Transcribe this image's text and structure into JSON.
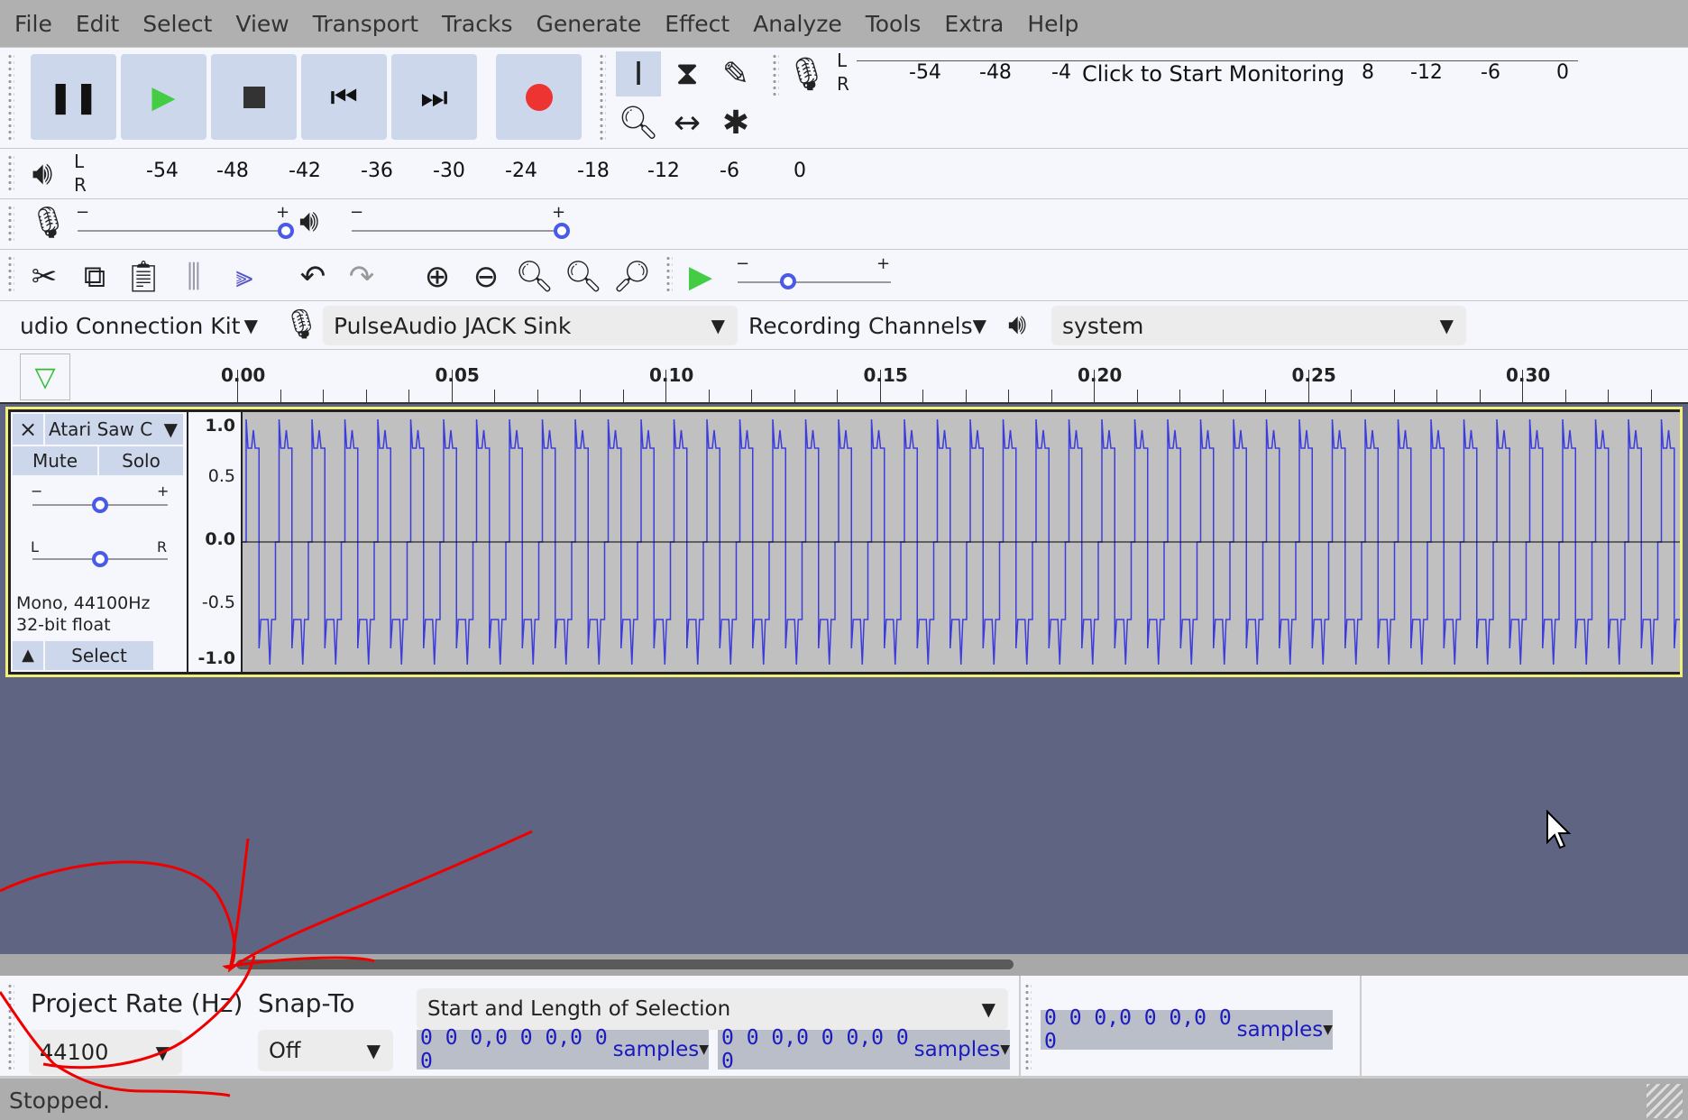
{
  "menu": [
    "File",
    "Edit",
    "Select",
    "View",
    "Transport",
    "Tracks",
    "Generate",
    "Effect",
    "Analyze",
    "Tools",
    "Extra",
    "Help"
  ],
  "transport": {
    "pause": "pause-icon",
    "play": "play-icon",
    "stop": "stop-icon",
    "skip_start": "skip-start-icon",
    "skip_end": "skip-end-icon",
    "record": "record-icon"
  },
  "record_meter": {
    "ticks": [
      "-54",
      "-48",
      "-4",
      "8",
      "-12",
      "-6",
      "0"
    ],
    "prompt": "Click to Start Monitoring",
    "l": "L",
    "r": "R"
  },
  "play_meter": {
    "ticks": [
      "-54",
      "-48",
      "-42",
      "-36",
      "-30",
      "-24",
      "-18",
      "-12",
      "-6",
      "0"
    ],
    "l": "L",
    "r": "R"
  },
  "mixer": {
    "minus": "−",
    "plus": "+",
    "rec_volume": 1.0,
    "play_volume": 1.0
  },
  "play_speed": {
    "minus": "−",
    "plus": "+",
    "value": 0.35
  },
  "devices": {
    "host": "udio Connection Kit",
    "playback": "PulseAudio JACK Sink",
    "channels": "Recording Channels",
    "output": "system"
  },
  "ruler": {
    "ticks": [
      "0.00",
      "0.05",
      "0.10",
      "0.15",
      "0.20",
      "0.25",
      "0.30"
    ]
  },
  "track": {
    "name": "Atari Saw C",
    "mute": "Mute",
    "solo": "Solo",
    "gain_minus": "−",
    "gain_plus": "+",
    "pan_l": "L",
    "pan_r": "R",
    "info1": "Mono, 44100Hz",
    "info2": "32-bit float",
    "select": "Select",
    "scale": [
      "1.0",
      "0.5",
      "0.0",
      "-0.5",
      "-1.0"
    ],
    "wave_color": "#3c3cdc",
    "gain": 0.5,
    "pan": 0.5
  },
  "selection": {
    "rate_label": "Project Rate (Hz)",
    "rate": "44100",
    "snap_label": "Snap-To",
    "snap": "Off",
    "mode": "Start and Length of Selection",
    "start": "0 0 0,0 0 0,0 0 0",
    "length": "0 0 0,0 0 0,0 0 0",
    "audio_pos": "0 0 0,0 0 0,0 0 0",
    "unit": "samples"
  },
  "status": "Stopped.",
  "colors": {
    "accent": "#3c3cdc",
    "background": "#5f6483",
    "track_border": "#f0f07a"
  }
}
